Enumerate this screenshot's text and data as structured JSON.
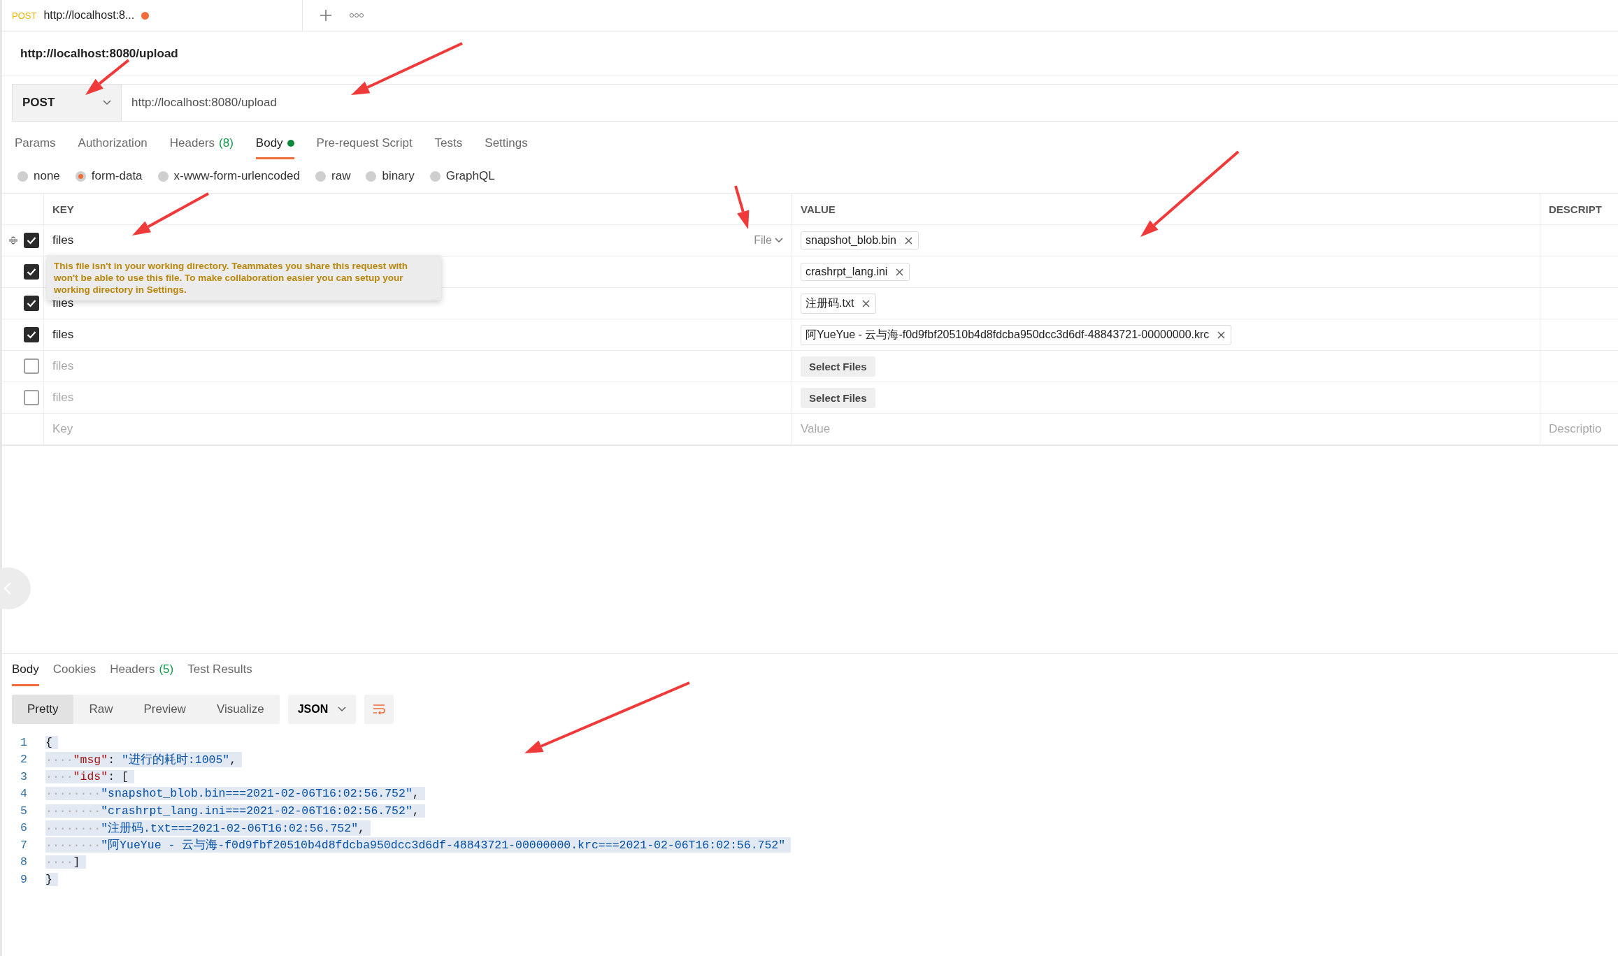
{
  "request_tab": {
    "method": "POST",
    "title": "http://localhost:8...",
    "unsaved": true
  },
  "request_name": "http://localhost:8080/upload",
  "method": "POST",
  "url": "http://localhost:8080/upload",
  "request_tabs": [
    {
      "label": "Params",
      "selected": false
    },
    {
      "label": "Authorization",
      "selected": false
    },
    {
      "label": "Headers",
      "count": "(8)",
      "selected": false
    },
    {
      "label": "Body",
      "dot": true,
      "selected": true
    },
    {
      "label": "Pre-request Script",
      "selected": false
    },
    {
      "label": "Tests",
      "selected": false
    },
    {
      "label": "Settings",
      "selected": false
    }
  ],
  "body_types": [
    {
      "label": "none",
      "selected": false
    },
    {
      "label": "form-data",
      "selected": true
    },
    {
      "label": "x-www-form-urlencoded",
      "selected": false
    },
    {
      "label": "raw",
      "selected": false
    },
    {
      "label": "binary",
      "selected": false
    },
    {
      "label": "GraphQL",
      "selected": false
    }
  ],
  "table": {
    "columns": [
      "KEY",
      "VALUE",
      "DESCRIPT"
    ],
    "rows": [
      {
        "kind": "file",
        "checked": true,
        "key": "files",
        "type": "File",
        "files": [
          "snapshot_blob.bin"
        ]
      },
      {
        "kind": "file",
        "checked": true,
        "files": [
          "crashrpt_lang.ini"
        ]
      },
      {
        "kind": "file",
        "checked": true,
        "key": "files",
        "files": [
          "注册码.txt"
        ]
      },
      {
        "kind": "file",
        "checked": true,
        "key": "files",
        "files": [
          "阿YueYue - 云与海-f0d9fbf20510b4d8fdcba950dcc3d6df-48843721-00000000.krc"
        ]
      },
      {
        "kind": "select",
        "checked": false,
        "key": "files",
        "button": "Select Files"
      },
      {
        "kind": "select",
        "checked": false,
        "key": "files",
        "button": "Select Files"
      }
    ],
    "new_row": {
      "key": "Key",
      "value": "Value",
      "description": "Descriptio"
    }
  },
  "tooltip": "This file isn't in your working directory. Teammates you share this request with won't be able to use this file. To make collaboration easier you can setup your working directory in Settings.",
  "response": {
    "tabs": [
      {
        "label": "Body",
        "selected": true
      },
      {
        "label": "Cookies",
        "selected": false
      },
      {
        "label": "Headers",
        "count": "(5)",
        "selected": false
      },
      {
        "label": "Test Results",
        "selected": false
      }
    ],
    "views": [
      {
        "label": "Pretty",
        "selected": true
      },
      {
        "label": "Raw",
        "selected": false
      },
      {
        "label": "Preview",
        "selected": false
      },
      {
        "label": "Visualize",
        "selected": false
      }
    ],
    "format": "JSON",
    "lines": [
      {
        "number": "1",
        "tokens": [
          {
            "kind": "punct",
            "text": "{"
          }
        ]
      },
      {
        "number": "2",
        "tokens": [
          {
            "kind": "ws",
            "text": "····"
          },
          {
            "kind": "key",
            "text": "\"msg\""
          },
          {
            "kind": "punct",
            "text": ": "
          },
          {
            "kind": "string",
            "text": "\"进行的耗时:1005\""
          },
          {
            "kind": "punct",
            "text": ","
          }
        ]
      },
      {
        "number": "3",
        "tokens": [
          {
            "kind": "ws",
            "text": "····"
          },
          {
            "kind": "key",
            "text": "\"ids\""
          },
          {
            "kind": "punct",
            "text": ": ["
          }
        ]
      },
      {
        "number": "4",
        "tokens": [
          {
            "kind": "ws",
            "text": "········"
          },
          {
            "kind": "string",
            "text": "\"snapshot_blob.bin===2021-02-06T16:02:56.752\""
          },
          {
            "kind": "punct",
            "text": ","
          }
        ]
      },
      {
        "number": "5",
        "tokens": [
          {
            "kind": "ws",
            "text": "········"
          },
          {
            "kind": "string",
            "text": "\"crashrpt_lang.ini===2021-02-06T16:02:56.752\""
          },
          {
            "kind": "punct",
            "text": ","
          }
        ]
      },
      {
        "number": "6",
        "tokens": [
          {
            "kind": "ws",
            "text": "········"
          },
          {
            "kind": "string",
            "text": "\"注册码.txt===2021-02-06T16:02:56.752\""
          },
          {
            "kind": "punct",
            "text": ","
          }
        ]
      },
      {
        "number": "7",
        "tokens": [
          {
            "kind": "ws",
            "text": "········"
          },
          {
            "kind": "string",
            "text": "\"阿YueYue - 云与海-f0d9fbf20510b4d8fdcba950dcc3d6df-48843721-00000000.krc===2021-02-06T16:02:56.752\""
          }
        ]
      },
      {
        "number": "8",
        "tokens": [
          {
            "kind": "ws",
            "text": "····"
          },
          {
            "kind": "punct",
            "text": "]"
          }
        ]
      },
      {
        "number": "9",
        "tokens": [
          {
            "kind": "punct",
            "text": "}"
          }
        ]
      }
    ]
  }
}
